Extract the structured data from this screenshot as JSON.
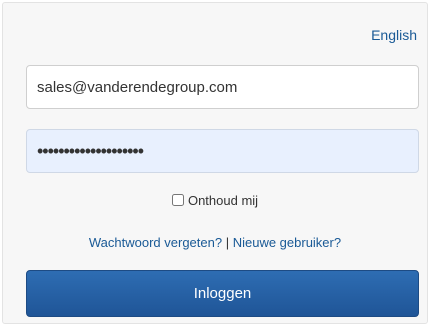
{
  "language_link": "English",
  "form": {
    "email_value": "sales@vanderendegroup.com",
    "password_value": "••••••••••••••••••••",
    "remember_label": "Onthoud mij",
    "remember_checked": false,
    "forgot_password": "Wachtwoord vergeten?",
    "separator": " | ",
    "new_user": "Nieuwe gebruiker?",
    "login_label": "Inloggen"
  }
}
